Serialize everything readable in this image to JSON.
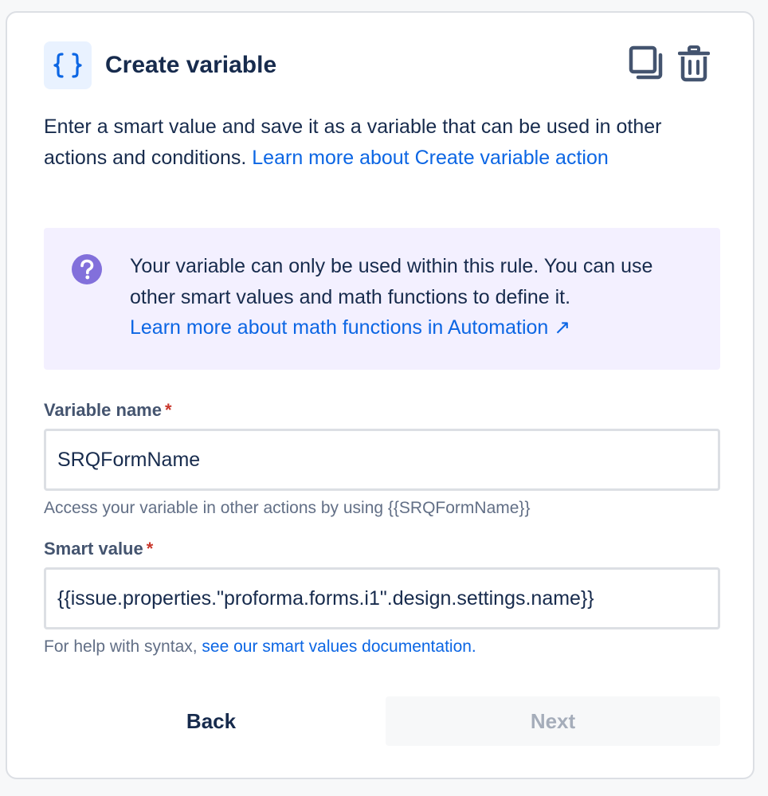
{
  "header": {
    "title": "Create variable"
  },
  "description": {
    "text": "Enter a smart value and save it as a variable that can be used in other actions and conditions. ",
    "link": "Learn more about Create variable action"
  },
  "info": {
    "text": "Your variable can only be used within this rule. You can use other smart values and math functions to define it.",
    "link": "Learn more about math functions in Automation",
    "link_arrow": "↗"
  },
  "variable_name": {
    "label": "Variable name",
    "required_marker": "*",
    "value": "SRQFormName",
    "helper": "Access your variable in other actions by using {{SRQFormName}}"
  },
  "smart_value": {
    "label": "Smart value",
    "required_marker": "*",
    "value": "{{issue.properties.\"proforma.forms.i1\".design.settings.name}}",
    "helper_text": "For help with syntax, ",
    "helper_link": "see our smart values documentation."
  },
  "buttons": {
    "back": "Back",
    "next": "Next"
  },
  "colors": {
    "link": "#0c66e4",
    "info_bg": "#f3f0ff",
    "info_icon": "#8270db",
    "required": "#c9372c",
    "icon_bg": "#e9f2ff"
  }
}
